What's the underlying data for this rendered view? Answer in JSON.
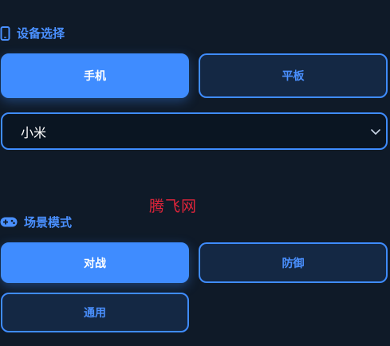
{
  "device_section": {
    "title": "设备选择",
    "icon": "phone-icon",
    "buttons": [
      {
        "label": "手机",
        "active": true
      },
      {
        "label": "平板",
        "active": false
      }
    ],
    "select": {
      "value": "小米",
      "icon": "chevron-down-icon"
    }
  },
  "watermark": "腾飞网",
  "scene_section": {
    "title": "场景模式",
    "icon": "gamepad-icon",
    "buttons": [
      {
        "label": "对战",
        "active": true
      },
      {
        "label": "防御",
        "active": false
      },
      {
        "label": "通用",
        "active": false
      }
    ]
  },
  "colors": {
    "background": "#0f1a28",
    "accent": "#3f8cff",
    "inactive_bg": "#142844",
    "watermark": "#e0243a"
  }
}
